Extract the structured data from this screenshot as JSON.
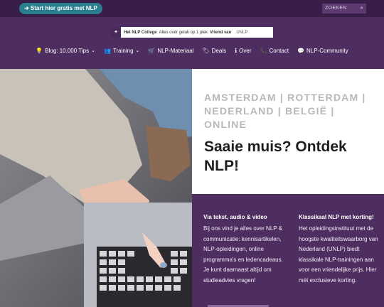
{
  "topbar": {
    "start_button": "➜ Start hier gratis met NLP",
    "search_placeholder": "ZOEKEN",
    "search_icon": "search-icon"
  },
  "header": {
    "logo": {
      "brand": "Het NLP College",
      "tagline": "Alles over geluk op 1 plek",
      "friend": "Vriend van",
      "partner": "UNLP"
    },
    "nav": [
      {
        "icon": "lightbulb-icon",
        "glyph": "💡",
        "label": "Blog: 10.000 Tips",
        "has_dropdown": true
      },
      {
        "icon": "users-icon",
        "glyph": "👥",
        "label": "Training",
        "has_dropdown": true
      },
      {
        "icon": "cart-icon",
        "glyph": "🛒",
        "label": "NLP-Materiaal",
        "has_dropdown": false
      },
      {
        "icon": "tag-icon",
        "glyph": "🏷",
        "label": "Deals",
        "has_dropdown": false
      },
      {
        "icon": "info-icon",
        "glyph": "ℹ",
        "label": "Over",
        "has_dropdown": false
      },
      {
        "icon": "phone-icon",
        "glyph": "📞",
        "label": "Contact",
        "has_dropdown": false
      },
      {
        "icon": "chat-icon",
        "glyph": "💬",
        "label": "NLP-Community",
        "has_dropdown": false
      }
    ]
  },
  "hero": {
    "cities": "AMSTERDAM | ROTTERDAM | NEDERLAND | BELGIË | ONLINE",
    "headline": "Saaie muis? Ontdek NLP!"
  },
  "columns": [
    {
      "title": "Via tekst, audio & video",
      "body": "Bij ons vind je alles over NLP & communicatie: kennisartikelen, NLP-opleidingen, online programma's en ledencadeaus. Je kunt daarnaast altijd om studieadvies vragen!"
    },
    {
      "title": "Klassikaal NLP met korting!",
      "body": "Het opleidingsinstituut met de hoogste kwaliteitswaarborg van Nederland (UNLP) biedt klassikale NLP-trainingen aan voor een vriendelijke prijs. Hier mét exclusieve korting."
    }
  ],
  "colors": {
    "topbar": "#3a1e4a",
    "header": "#4e2d60",
    "accent_button": "#2a7f8f",
    "cities_text": "#b8b8b8"
  }
}
